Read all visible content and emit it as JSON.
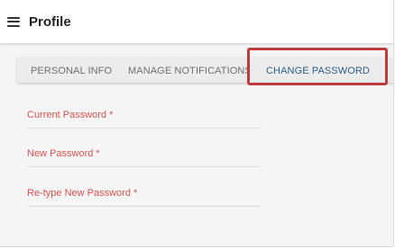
{
  "header": {
    "menu_icon": "hamburger-menu-icon",
    "title": "Profile"
  },
  "tabs": [
    {
      "label": "PERSONAL INFO",
      "active": false
    },
    {
      "label": "MANAGE NOTIFICATIONS",
      "active": false
    },
    {
      "label": "CHANGE PASSWORD",
      "active": true
    }
  ],
  "form": {
    "fields": [
      {
        "label": "Current Password *",
        "value": ""
      },
      {
        "label": "New Password *",
        "value": ""
      },
      {
        "label": "Re-type New Password *",
        "value": ""
      }
    ]
  },
  "colors": {
    "active_tab": "#2a5f86",
    "field_label": "#d9534f",
    "highlight_border": "#c0393b"
  }
}
